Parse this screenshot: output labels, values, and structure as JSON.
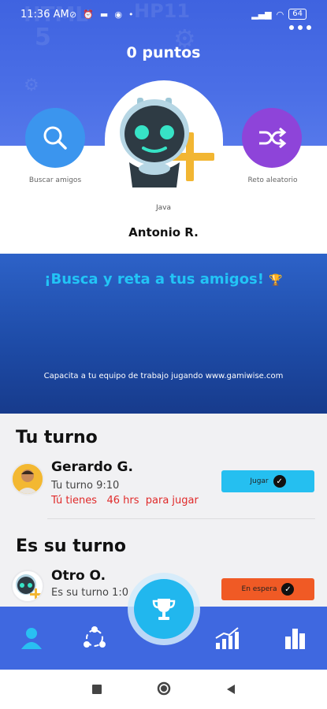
{
  "status_bar": {
    "time": "11:36 AM",
    "battery": "64"
  },
  "header": {
    "points": "0 puntos"
  },
  "actions": {
    "search_friends": "Buscar amigos",
    "random_challenge": "Reto aleatorio"
  },
  "profile": {
    "avatar_tag": "Java",
    "name": "Antonio R."
  },
  "banner": {
    "title": "¡Busca y reta a tus amigos!",
    "subtitle": "Capacita a tu equipo de trabajo jugando www.gamiwise.com"
  },
  "your_turn": {
    "title": "Tu turno",
    "player": {
      "name": "Gerardo G.",
      "turn": "Tu turno 9:10",
      "warn_prefix": "Tú tienes",
      "warn_hours": "46 hrs",
      "warn_suffix": "para jugar",
      "button": "Jugar"
    }
  },
  "their_turn": {
    "title": "Es su turno",
    "player": {
      "name": "Otro O.",
      "turn": "Es su turno 1:0",
      "button": "En espera"
    }
  },
  "colors": {
    "header_blue": "#3f63e0",
    "search_blue": "#3b95ee",
    "random_purple": "#8e44d9",
    "banner_title_cyan": "#22c4f6",
    "play_cyan": "#25bff0",
    "wait_orange": "#f05a25",
    "warn_red": "#e02a2a"
  },
  "icons": {
    "search": "search-icon",
    "random": "shuffle-icon",
    "profile": "user-icon",
    "friends": "network-icon",
    "ranking": "trophy-icon",
    "stats": "growth-chart-icon",
    "leaderboard": "bar-chart-icon"
  }
}
